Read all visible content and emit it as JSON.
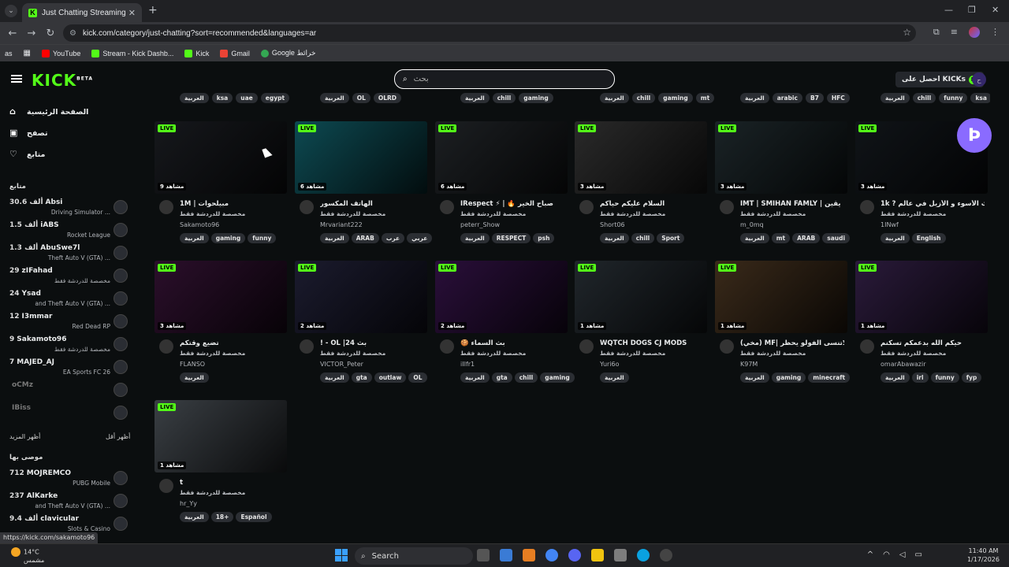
{
  "browser": {
    "tab_title": "Just Chatting Streaming - Live S",
    "url": "kick.com/category/just-chatting?sort=recommended&languages=ar",
    "bookmarks": [
      "YouTube",
      "Stream - Kick Dashb...",
      "Kick",
      "Gmail",
      "Google خرائط"
    ],
    "bookmark_prefix": "as",
    "status_url": "https://kick.com/sakamoto96"
  },
  "header": {
    "logo": "KICK",
    "logo_badge": "BETA",
    "search_placeholder": "بحث",
    "kicks_label": "احصل على KICKs"
  },
  "sidebar": {
    "nav": [
      {
        "label": "الصفحة الرئيسية",
        "icon": "home-icon"
      },
      {
        "label": "تصفح",
        "icon": "browse-icon"
      },
      {
        "label": "متابع",
        "icon": "heart-icon"
      }
    ],
    "following_title": "متابع",
    "following": [
      {
        "name": "Absi",
        "count": "30.6 ألف",
        "sub": "Driving Simulator ..."
      },
      {
        "name": "iABS",
        "count": "1.5 ألف",
        "sub": "Rocket League"
      },
      {
        "name": "AbuSwe7l",
        "count": "1.3 ألف",
        "sub": "Theft Auto V (GTA) ..."
      },
      {
        "name": "zIFahad",
        "count": "29",
        "sub": "مخصصة للدردشة فقط"
      },
      {
        "name": "Ysad",
        "count": "24",
        "sub": "and Theft Auto V (GTA) ..."
      },
      {
        "name": "I3mmar",
        "count": "12",
        "sub": "Red Dead RP"
      },
      {
        "name": "Sakamoto96",
        "count": "9",
        "sub": "مخصصة للدردشة فقط"
      },
      {
        "name": "MAJED_AJ",
        "count": "7",
        "sub": "EA Sports FC 26"
      },
      {
        "name": "oCMz",
        "count": "",
        "sub": ""
      },
      {
        "name": "IBiss",
        "count": "",
        "sub": ""
      }
    ],
    "show_more": "أظهر المزيد",
    "show_less": "أظهر أقل",
    "recommended_title": "موصى بها",
    "recommended": [
      {
        "name": "MOJREMCO",
        "count": "712",
        "sub": "PUBG Mobile"
      },
      {
        "name": "AlKarke",
        "count": "237",
        "sub": "and Theft Auto V (GTA) ..."
      },
      {
        "name": "clavicular",
        "count": "9.4 ألف",
        "sub": "Slots & Casino"
      }
    ]
  },
  "top_tags": [
    [
      "العربية",
      "ksa",
      "uae",
      "egypt"
    ],
    [
      "العربية",
      "OL",
      "OLRD"
    ],
    [
      "العربية",
      "chill",
      "gaming"
    ],
    [
      "العربية",
      "chill",
      "gaming",
      "mt"
    ],
    [
      "العربية",
      "arabic",
      "B7",
      "HFC"
    ],
    [
      "العربية",
      "chill",
      "funny",
      "ksa"
    ]
  ],
  "live_label": "LIVE",
  "cards": [
    {
      "title": "1M | مبيلحوات",
      "cat": "مخصصة للدردشة فقط",
      "user": "Sakamoto96",
      "viewers": "9 مشاهد",
      "tags": [
        "العربية",
        "gaming",
        "funny"
      ],
      "bg": "#16181c"
    },
    {
      "title": "الهاتف المكسور",
      "cat": "مخصصة للدردشة فقط",
      "user": "Mrvariant222",
      "viewers": "6 مشاهد",
      "tags": [
        "العربية",
        "ARAB",
        "عرب",
        "عربي"
      ],
      "bg": "#0d4a52"
    },
    {
      "title": "IRespect ⚡ | 🔥 صباح الخير",
      "cat": "مخصصة للدردشة فقط",
      "user": "peterr_Show",
      "viewers": "6 مشاهد",
      "tags": [
        "العربية",
        "RESPECT",
        "psh"
      ],
      "bg": "#1c1f22"
    },
    {
      "title": "السلام عليكم حياكم",
      "cat": "مخصصة للدردشة فقط",
      "user": "Short06",
      "viewers": "3 مشاهد",
      "tags": [
        "العربية",
        "chill",
        "Sport"
      ],
      "bg": "#2a2a2a"
    },
    {
      "title": "IMT | SMIHAN FAMLY | يقين",
      "cat": "مخصصة للدردشة فقط",
      "user": "m_0mq",
      "viewers": "3 مشاهد",
      "tags": [
        "العربية",
        "mt",
        "ARAB",
        "saudi"
      ],
      "bg": "#1a2326"
    },
    {
      "title": "1k ? البث الأسوء و الأزيل في عالم",
      "cat": "مخصصة للدردشة فقط",
      "user": "1INwf",
      "viewers": "3 مشاهد",
      "tags": [
        "العربية",
        "English"
      ],
      "bg": "#101418"
    },
    {
      "title": "تضيع وقتكم",
      "cat": "مخصصة للدردشة فقط",
      "user": "FLANSO",
      "viewers": "3 مشاهد",
      "tags": [
        "العربية"
      ],
      "bg": "#2b0f2b"
    },
    {
      "title": "! - OL |24 بث",
      "cat": "مخصصة للدردشة فقط",
      "user": "VICTOR_Peter",
      "viewers": "2 مشاهد",
      "tags": [
        "العربية",
        "gta",
        "outlaw",
        "OL"
      ],
      "bg": "#1b1b2e"
    },
    {
      "title": "🍪 بث السماء",
      "cat": "مخصصة للدردشة فقط",
      "user": "iIIfr1",
      "viewers": "2 مشاهد",
      "tags": [
        "العربية",
        "gta",
        "chill",
        "gaming"
      ],
      "bg": "#2a0f3a"
    },
    {
      "title": "WQTCH DOGS CJ MODS",
      "cat": "مخصصة للدردشة فقط",
      "user": "Yuri6o",
      "viewers": "1 مشاهد",
      "tags": [
        "العربية"
      ],
      "bg": "#20262b"
    },
    {
      "title": "(مخي) MF| بث الان لاتنسى الفولو يحظر",
      "cat": "مخصصة للدردشة فقط",
      "user": "K97M",
      "viewers": "1 مشاهد",
      "tags": [
        "العربية",
        "gaming",
        "minecraft"
      ],
      "bg": "#3a2a1a"
    },
    {
      "title": "حيكم الله بدعمكم تسكنم",
      "cat": "مخصصة للدردشة فقط",
      "user": "omarAbawazir",
      "viewers": "1 مشاهد",
      "tags": [
        "العربية",
        "irl",
        "funny",
        "fyp"
      ],
      "bg": "#2a1a3a"
    },
    {
      "title": "t",
      "cat": "مخصصة للدردشة فقط",
      "user": "hr_Yy",
      "viewers": "1 مشاهد",
      "tags": [
        "العربية",
        "18+",
        "Español"
      ],
      "bg": "#3a3f44"
    }
  ],
  "taskbar": {
    "weather_temp": "14°C",
    "weather_desc": "مشمس",
    "search_label": "Search",
    "time": "11:40 AM",
    "date": "1/17/2026"
  }
}
